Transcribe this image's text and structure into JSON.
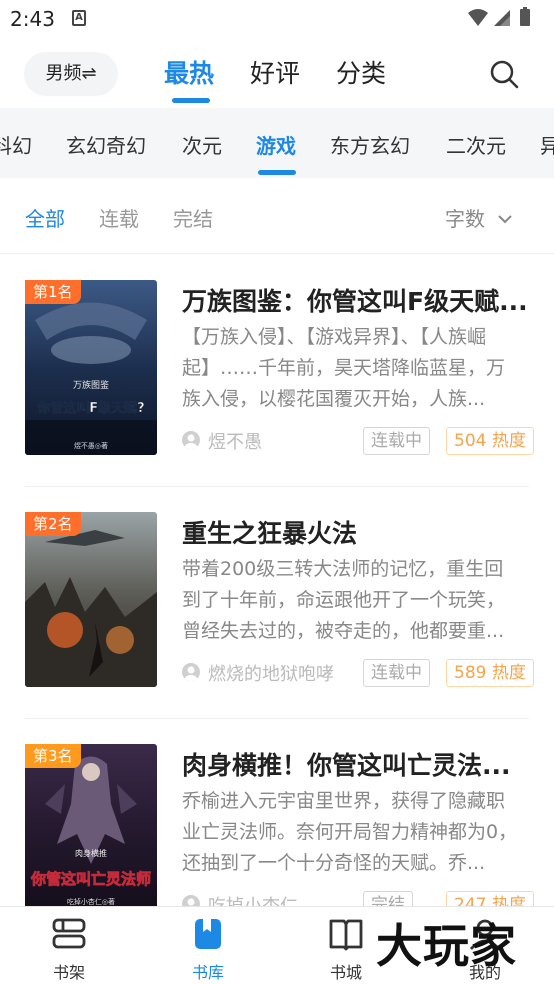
{
  "status_bar": {
    "time": "2:43",
    "notification_letter": "A"
  },
  "header": {
    "gender_switch_label": "男频⇌",
    "tabs": [
      {
        "label": "最热",
        "active": true
      },
      {
        "label": "好评",
        "active": false
      },
      {
        "label": "分类",
        "active": false
      }
    ],
    "search_icon": "search-icon"
  },
  "genres": [
    "科幻",
    "玄幻奇幻",
    "次元",
    "游戏",
    "东方玄幻",
    "二次元",
    "异"
  ],
  "genres_active": "游戏",
  "filters": {
    "options": [
      "全部",
      "连载",
      "完结"
    ],
    "active": "全部",
    "sort_label": "字数"
  },
  "books": [
    {
      "rank": "第1名",
      "title": "万族图鉴：你管这叫F级天赋...",
      "description": "【万族入侵】、【游戏异界】、【人族崛起】……千年前，昊天塔降临蓝星，万族入侵，以樱花国覆灭开始，人族...",
      "author": "煜不愚",
      "status": "连载中",
      "heat": "504 热度",
      "cover_text_top": "万族图鉴",
      "cover_text_main": "你管这叫F级天赋?",
      "cover_text_author": "煜不愚◎著"
    },
    {
      "rank": "第2名",
      "title": "重生之狂暴火法",
      "description": "带着200级三转大法师的记忆，重生回到了十年前，命运跟他开了一个玩笑，曾经失去过的，被夺走的，他都要重...",
      "author": "燃烧的地狱咆哮",
      "status": "连载中",
      "heat": "589 热度"
    },
    {
      "rank": "第3名",
      "title": "肉身横推！你管这叫亡灵法...",
      "description": "乔榆进入元宇宙里世界，获得了隐藏职业亡灵法师。奈何开局智力精神都为0，还抽到了一个十分奇怪的天赋。乔...",
      "author": "吃掉小杏仁",
      "status": "完结",
      "heat": "247 热度",
      "cover_text_top": "肉身横推",
      "cover_text_main": "你管这叫亡灵法师",
      "cover_text_author": "吃掉小杏仁◎著"
    }
  ],
  "bottom_nav": [
    {
      "label": "书架",
      "icon": "bookshelf-icon",
      "active": false
    },
    {
      "label": "书库",
      "icon": "book-library-icon",
      "active": true
    },
    {
      "label": "书城",
      "icon": "book-store-icon",
      "active": false
    },
    {
      "label": "我的",
      "icon": "profile-icon",
      "active": false
    }
  ],
  "watermark": "大玩家",
  "colors": {
    "accent": "#1e88e5",
    "rank_badge": "#ff6f2c",
    "heat_tag": "#f5a44a"
  }
}
